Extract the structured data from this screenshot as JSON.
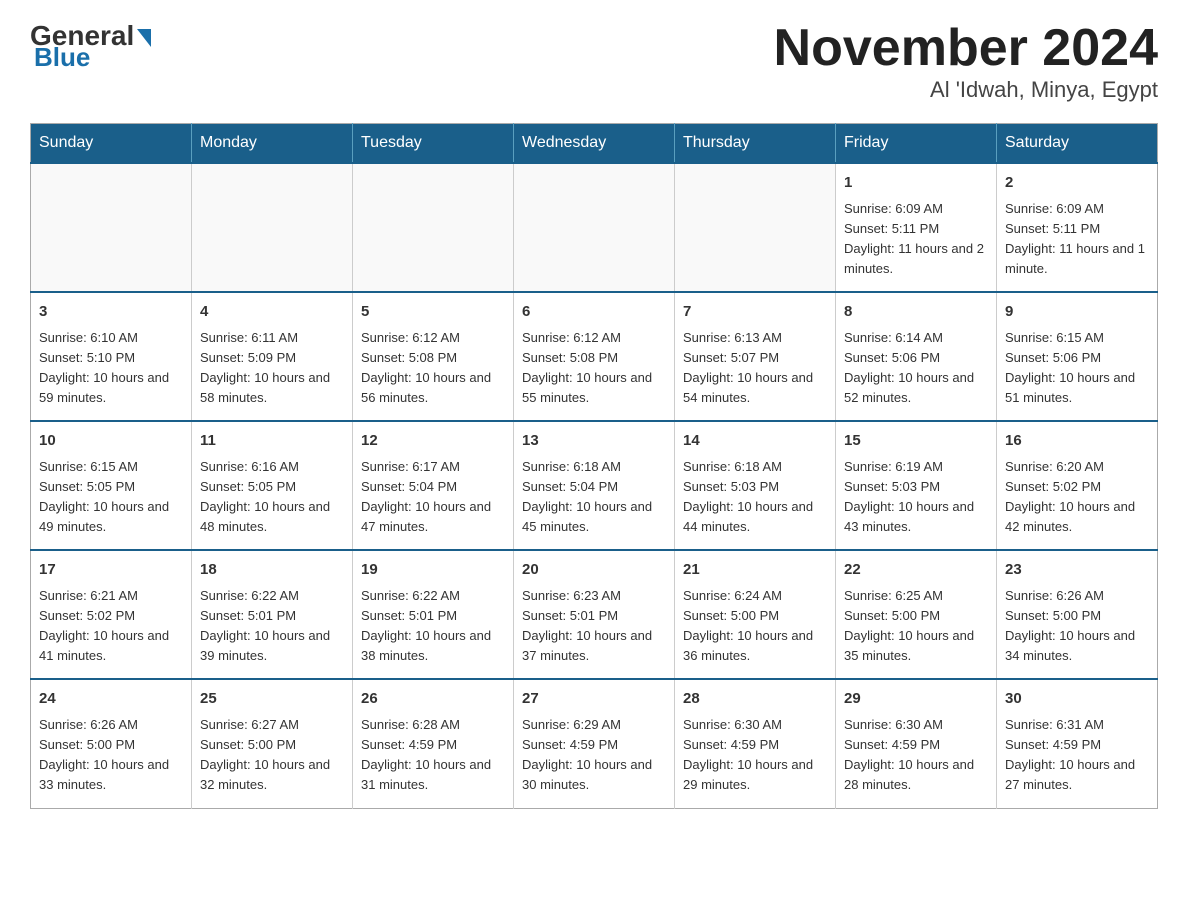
{
  "header": {
    "logo_general": "General",
    "logo_blue": "Blue",
    "title": "November 2024",
    "subtitle": "Al 'Idwah, Minya, Egypt"
  },
  "calendar": {
    "days_of_week": [
      "Sunday",
      "Monday",
      "Tuesday",
      "Wednesday",
      "Thursday",
      "Friday",
      "Saturday"
    ],
    "weeks": [
      [
        {
          "day": "",
          "info": ""
        },
        {
          "day": "",
          "info": ""
        },
        {
          "day": "",
          "info": ""
        },
        {
          "day": "",
          "info": ""
        },
        {
          "day": "",
          "info": ""
        },
        {
          "day": "1",
          "info": "Sunrise: 6:09 AM\nSunset: 5:11 PM\nDaylight: 11 hours and 2 minutes."
        },
        {
          "day": "2",
          "info": "Sunrise: 6:09 AM\nSunset: 5:11 PM\nDaylight: 11 hours and 1 minute."
        }
      ],
      [
        {
          "day": "3",
          "info": "Sunrise: 6:10 AM\nSunset: 5:10 PM\nDaylight: 10 hours and 59 minutes."
        },
        {
          "day": "4",
          "info": "Sunrise: 6:11 AM\nSunset: 5:09 PM\nDaylight: 10 hours and 58 minutes."
        },
        {
          "day": "5",
          "info": "Sunrise: 6:12 AM\nSunset: 5:08 PM\nDaylight: 10 hours and 56 minutes."
        },
        {
          "day": "6",
          "info": "Sunrise: 6:12 AM\nSunset: 5:08 PM\nDaylight: 10 hours and 55 minutes."
        },
        {
          "day": "7",
          "info": "Sunrise: 6:13 AM\nSunset: 5:07 PM\nDaylight: 10 hours and 54 minutes."
        },
        {
          "day": "8",
          "info": "Sunrise: 6:14 AM\nSunset: 5:06 PM\nDaylight: 10 hours and 52 minutes."
        },
        {
          "day": "9",
          "info": "Sunrise: 6:15 AM\nSunset: 5:06 PM\nDaylight: 10 hours and 51 minutes."
        }
      ],
      [
        {
          "day": "10",
          "info": "Sunrise: 6:15 AM\nSunset: 5:05 PM\nDaylight: 10 hours and 49 minutes."
        },
        {
          "day": "11",
          "info": "Sunrise: 6:16 AM\nSunset: 5:05 PM\nDaylight: 10 hours and 48 minutes."
        },
        {
          "day": "12",
          "info": "Sunrise: 6:17 AM\nSunset: 5:04 PM\nDaylight: 10 hours and 47 minutes."
        },
        {
          "day": "13",
          "info": "Sunrise: 6:18 AM\nSunset: 5:04 PM\nDaylight: 10 hours and 45 minutes."
        },
        {
          "day": "14",
          "info": "Sunrise: 6:18 AM\nSunset: 5:03 PM\nDaylight: 10 hours and 44 minutes."
        },
        {
          "day": "15",
          "info": "Sunrise: 6:19 AM\nSunset: 5:03 PM\nDaylight: 10 hours and 43 minutes."
        },
        {
          "day": "16",
          "info": "Sunrise: 6:20 AM\nSunset: 5:02 PM\nDaylight: 10 hours and 42 minutes."
        }
      ],
      [
        {
          "day": "17",
          "info": "Sunrise: 6:21 AM\nSunset: 5:02 PM\nDaylight: 10 hours and 41 minutes."
        },
        {
          "day": "18",
          "info": "Sunrise: 6:22 AM\nSunset: 5:01 PM\nDaylight: 10 hours and 39 minutes."
        },
        {
          "day": "19",
          "info": "Sunrise: 6:22 AM\nSunset: 5:01 PM\nDaylight: 10 hours and 38 minutes."
        },
        {
          "day": "20",
          "info": "Sunrise: 6:23 AM\nSunset: 5:01 PM\nDaylight: 10 hours and 37 minutes."
        },
        {
          "day": "21",
          "info": "Sunrise: 6:24 AM\nSunset: 5:00 PM\nDaylight: 10 hours and 36 minutes."
        },
        {
          "day": "22",
          "info": "Sunrise: 6:25 AM\nSunset: 5:00 PM\nDaylight: 10 hours and 35 minutes."
        },
        {
          "day": "23",
          "info": "Sunrise: 6:26 AM\nSunset: 5:00 PM\nDaylight: 10 hours and 34 minutes."
        }
      ],
      [
        {
          "day": "24",
          "info": "Sunrise: 6:26 AM\nSunset: 5:00 PM\nDaylight: 10 hours and 33 minutes."
        },
        {
          "day": "25",
          "info": "Sunrise: 6:27 AM\nSunset: 5:00 PM\nDaylight: 10 hours and 32 minutes."
        },
        {
          "day": "26",
          "info": "Sunrise: 6:28 AM\nSunset: 4:59 PM\nDaylight: 10 hours and 31 minutes."
        },
        {
          "day": "27",
          "info": "Sunrise: 6:29 AM\nSunset: 4:59 PM\nDaylight: 10 hours and 30 minutes."
        },
        {
          "day": "28",
          "info": "Sunrise: 6:30 AM\nSunset: 4:59 PM\nDaylight: 10 hours and 29 minutes."
        },
        {
          "day": "29",
          "info": "Sunrise: 6:30 AM\nSunset: 4:59 PM\nDaylight: 10 hours and 28 minutes."
        },
        {
          "day": "30",
          "info": "Sunrise: 6:31 AM\nSunset: 4:59 PM\nDaylight: 10 hours and 27 minutes."
        }
      ]
    ]
  }
}
